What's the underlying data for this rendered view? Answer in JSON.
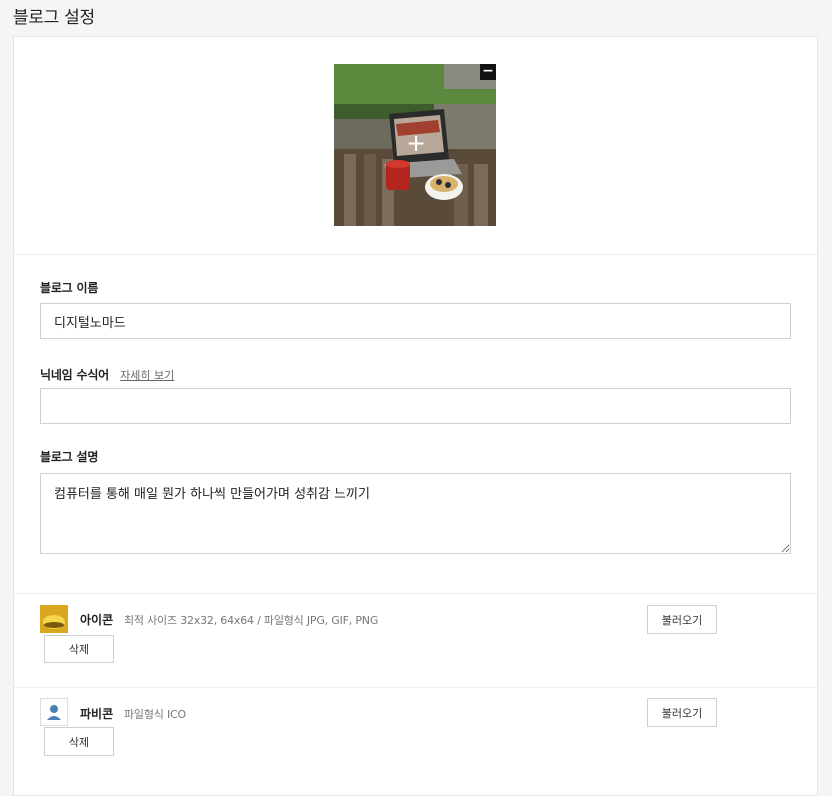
{
  "page": {
    "title": "블로그 설정"
  },
  "cover": {
    "remove_symbol": "−",
    "add_symbol": "+"
  },
  "form": {
    "blog_name": {
      "label": "블로그 이름",
      "value": "디지털노마드"
    },
    "nickname_modifier": {
      "label": "닉네임 수식어",
      "link": "자세히 보기",
      "value": ""
    },
    "blog_description": {
      "label": "블로그 설명",
      "value": "컴퓨터를 통해 매일 뭔가 하나씩 만들어가며 성취감 느끼기"
    }
  },
  "icon_row": {
    "name": "아이콘",
    "description": "최적 사이즈 32x32, 64x64 / 파일형식 JPG, GIF, PNG",
    "load_label": "불러오기",
    "delete_label": "삭제"
  },
  "favicon_row": {
    "name": "파비콘",
    "description": "파일형식 ICO",
    "load_label": "불러오기",
    "delete_label": "삭제"
  },
  "colors": {
    "border": "#cfcfcf",
    "panel_bg": "#ffffff",
    "page_bg": "#f5f5f5"
  }
}
